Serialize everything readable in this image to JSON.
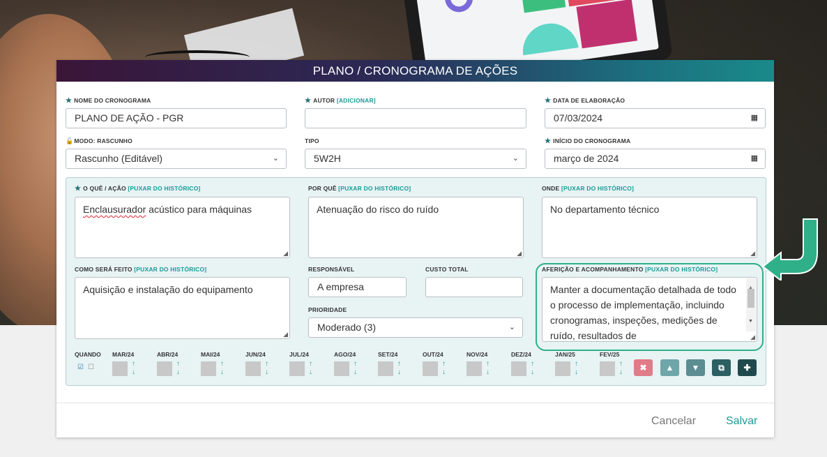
{
  "dialog": {
    "title": "PLANO / CRONOGRAMA DE AÇÕES"
  },
  "fields": {
    "nome_label": "NOME DO CRONOGRAMA",
    "nome_value": "PLANO DE AÇÃO - PGR",
    "autor_label": "AUTOR",
    "autor_link": "[ADICIONAR]",
    "autor_value": "",
    "data_label": "DATA DE ELABORAÇÃO",
    "data_value": "07/03/2024",
    "modo_label": "MODO: RASCUNHO",
    "modo_value": "Rascunho (Editável)",
    "tipo_label": "TIPO",
    "tipo_value": "5W2H",
    "inicio_label": "INÍCIO DO CRONOGRAMA",
    "inicio_value": "março de 2024"
  },
  "action": {
    "history_link": "[PUXAR DO HISTÓRICO]",
    "oque_label": "O QUÊ / AÇÃO",
    "oque_value_underlined": "Enclausurador",
    "oque_value_rest": " acústico para máquinas",
    "porque_label": "POR QUÊ",
    "porque_value": "Atenuação do risco do ruído",
    "onde_label": "ONDE",
    "onde_value": "No departamento técnico",
    "como_label": "COMO SERÁ FEITO",
    "como_value": "Aquisição e instalação do equipamento",
    "responsavel_label": "RESPONSÁVEL",
    "responsavel_value": "A empresa",
    "custo_label": "CUSTO TOTAL",
    "custo_value": "",
    "prioridade_label": "PRIORIDADE",
    "prioridade_value": "Moderado (3)",
    "afericao_label": "AFERIÇÃO E ACOMPANHAMENTO",
    "afericao_value": "Manter a documentação detalhada de todo o processo de implementação, incluindo cronogramas, inspeções, medições de ruído, resultados de"
  },
  "schedule": {
    "quando_label": "QUANDO",
    "months": [
      "MAR/24",
      "ABR/24",
      "MAI/24",
      "JUN/24",
      "JUL/24",
      "AGO/24",
      "SET/24",
      "OUT/24",
      "NOV/24",
      "DEZ/24",
      "JAN/25",
      "FEV/25"
    ]
  },
  "icons": {
    "star": "★",
    "calendar": "▦",
    "chevron": "⌄",
    "arrow_up": "↑",
    "arrow_down": "↓",
    "remove": "✖",
    "move_up": "▲",
    "move_down": "▼",
    "copy": "⧉",
    "add": "✚"
  },
  "colors": {
    "accent": "#1a9a9a",
    "callout": "#2fb089",
    "remove_btn": "#e07b87",
    "up_btn": "#6fa6aa",
    "down_btn": "#5b8d92",
    "copy_btn": "#2c5f62",
    "add_btn": "#1f4a4d"
  },
  "footer": {
    "cancel": "Cancelar",
    "save": "Salvar"
  }
}
